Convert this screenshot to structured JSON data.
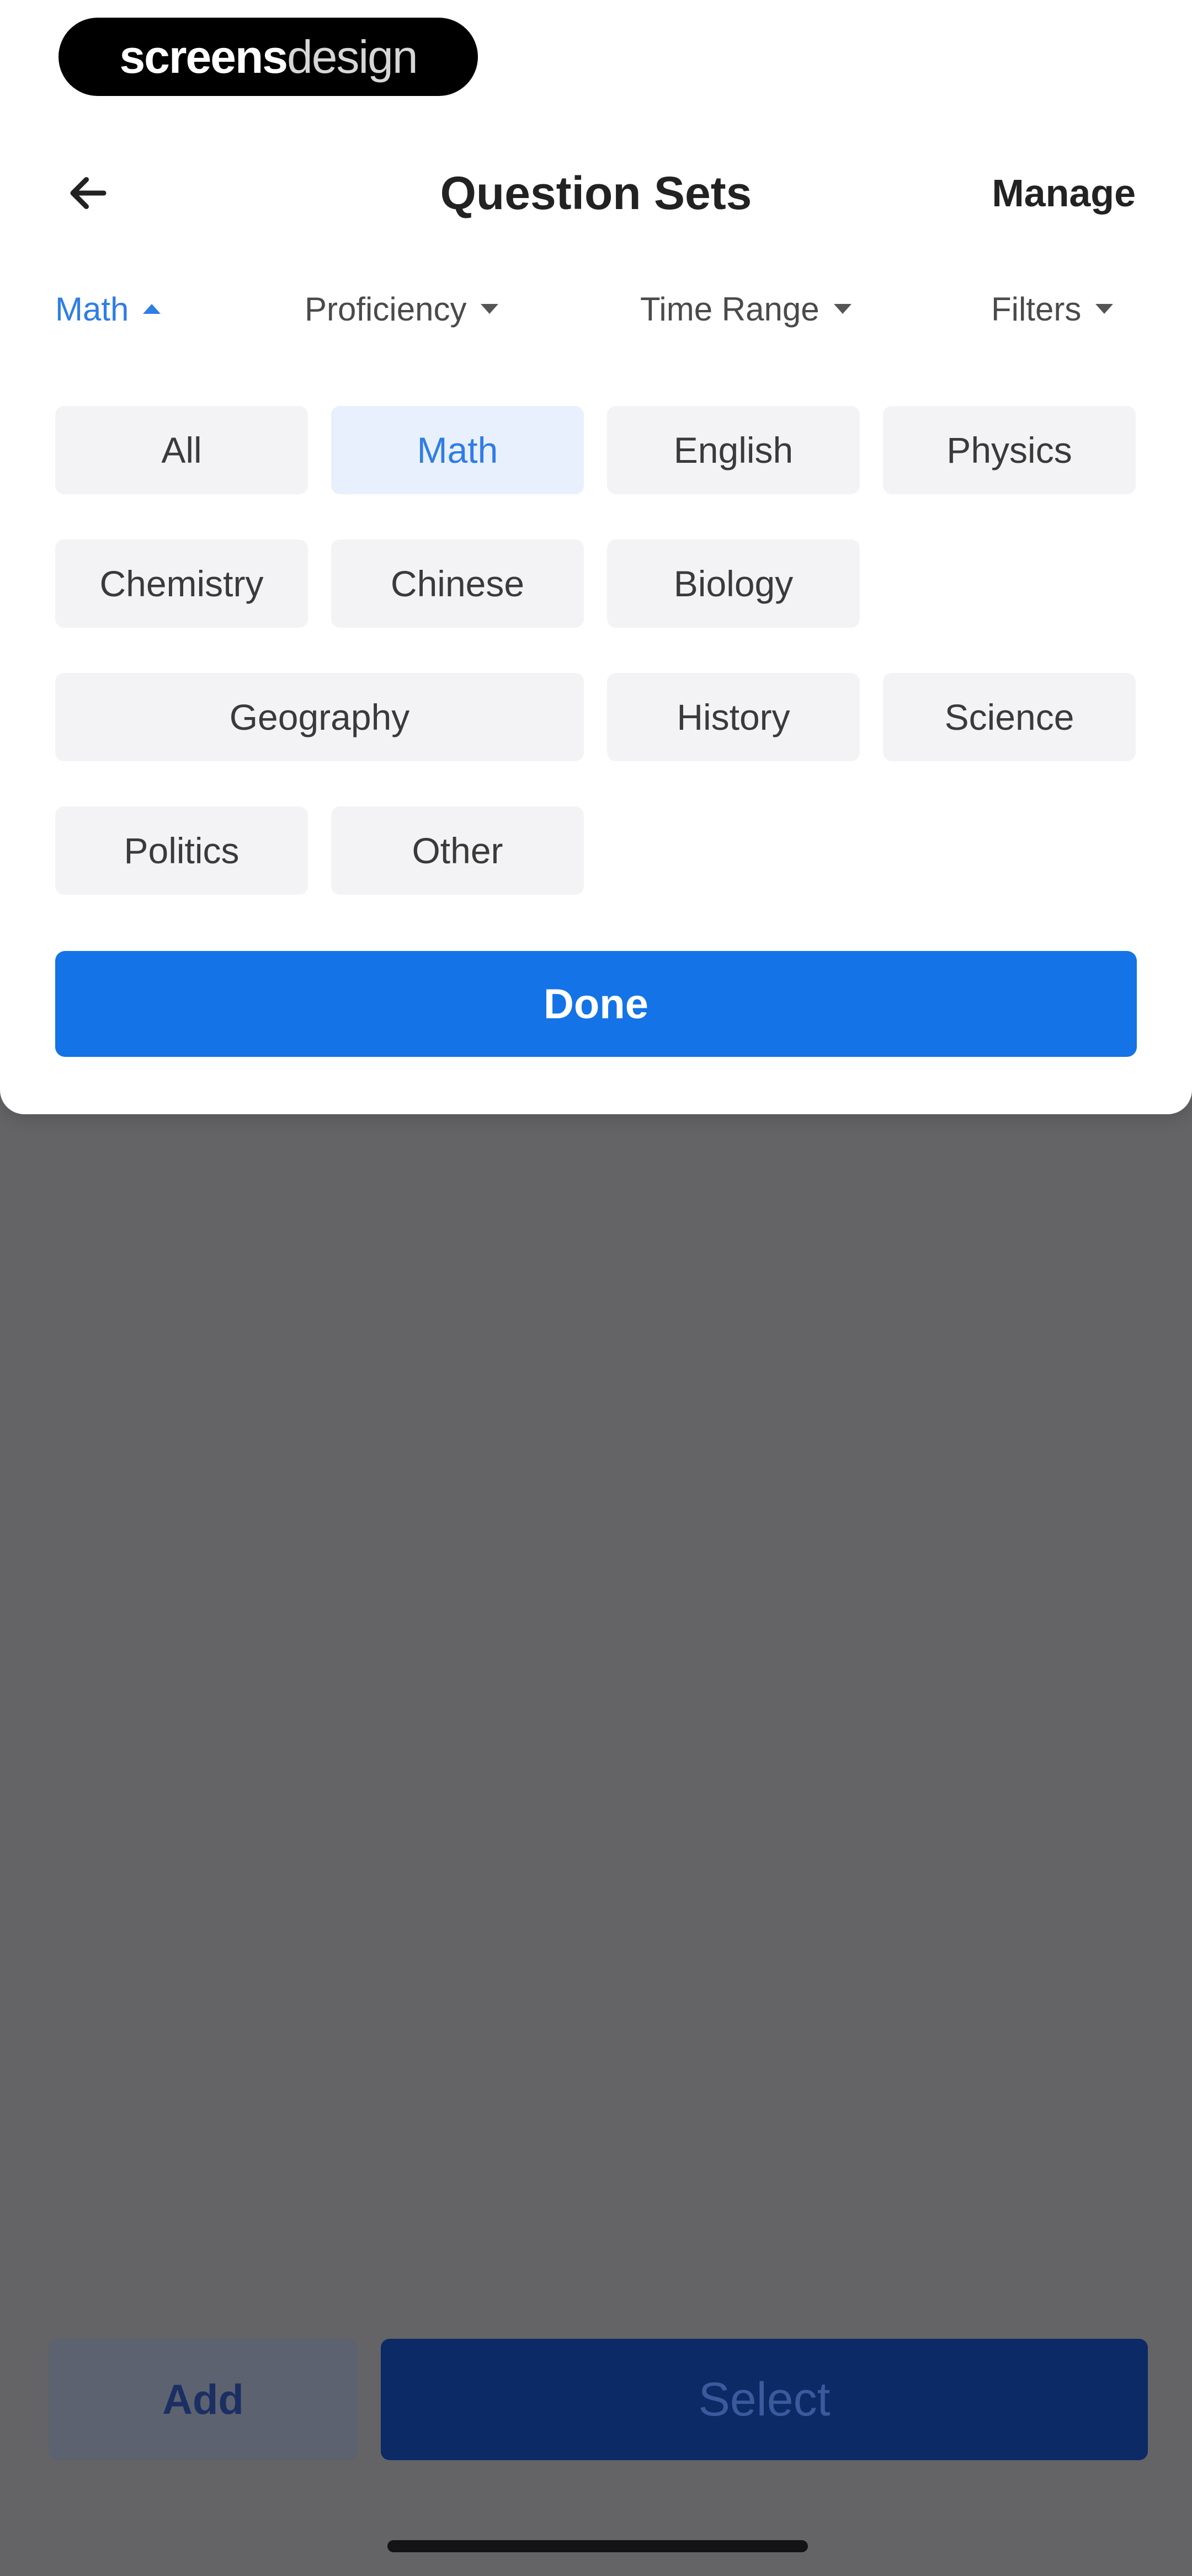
{
  "brand": {
    "part1": "screens",
    "part2": "design"
  },
  "header": {
    "title": "Question Sets",
    "manage_label": "Manage",
    "back_icon": "arrow-left-icon"
  },
  "filters": [
    {
      "label": "Math",
      "active": true,
      "icon": "caret-up-icon"
    },
    {
      "label": "Proficiency",
      "active": false,
      "icon": "caret-down-icon"
    },
    {
      "label": "Time Range",
      "active": false,
      "icon": "caret-down-icon"
    },
    {
      "label": "Filters",
      "active": false,
      "icon": "caret-down-icon"
    }
  ],
  "subjects": [
    {
      "label": "All",
      "selected": false
    },
    {
      "label": "Math",
      "selected": true
    },
    {
      "label": "English",
      "selected": false
    },
    {
      "label": "Physics",
      "selected": false
    },
    {
      "label": "Chemistry",
      "selected": false
    },
    {
      "label": "Chinese",
      "selected": false
    },
    {
      "label": "Biology",
      "selected": false
    },
    {
      "label": "Geography",
      "selected": false
    },
    {
      "label": "History",
      "selected": false
    },
    {
      "label": "Science",
      "selected": false
    },
    {
      "label": "Politics",
      "selected": false
    },
    {
      "label": "Other",
      "selected": false
    }
  ],
  "done_label": "Done",
  "bottom": {
    "add_label": "Add",
    "select_label": "Select"
  },
  "colors": {
    "accent": "#1473e6",
    "accent_text": "#2f7de6",
    "selected_chip_bg": "#e9f0fd",
    "chip_bg": "#f3f3f5",
    "overlay": "#646466"
  }
}
